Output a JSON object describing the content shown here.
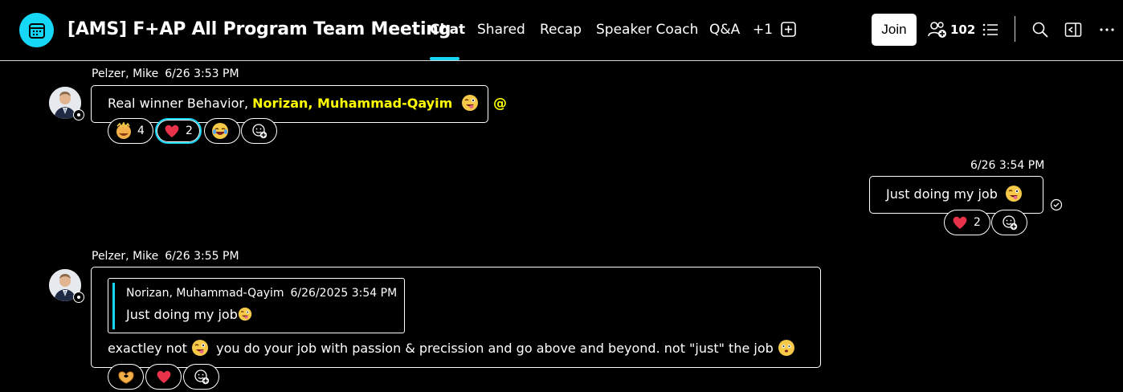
{
  "header": {
    "title": "[AMS] F+AP All Program Team Meeting",
    "tabs": [
      {
        "label": "Chat",
        "active": true
      },
      {
        "label": "Shared"
      },
      {
        "label": "Recap"
      },
      {
        "label": "Speaker Coach"
      },
      {
        "label": "Q&A"
      },
      {
        "label": "+1"
      }
    ],
    "join_label": "Join",
    "participant_count": "102",
    "accent": "#16d7f6"
  },
  "messages": [
    {
      "sender": "Pelzer, Mike",
      "time": "6/26 3:53 PM",
      "text_prefix": "Real winner Behavior, ",
      "mention": "Norizan, Muhammad-Qayim",
      "mention_symbol": "@",
      "reactions": [
        {
          "emoji": "clap-emoji",
          "count": "4"
        },
        {
          "emoji": "heart-emoji",
          "count": "2"
        },
        {
          "emoji": "laugh-emoji",
          "count": ""
        }
      ]
    },
    {
      "own": true,
      "time": "6/26 3:54 PM",
      "text": "Just doing my job",
      "reactions": [
        {
          "emoji": "heart-emoji",
          "count": "2"
        }
      ]
    },
    {
      "sender": "Pelzer, Mike",
      "time": "6/26 3:55 PM",
      "quote": {
        "author": "Norizan, Muhammad-Qayim",
        "time": "6/26/2025 3:54 PM",
        "text": "Just doing my job"
      },
      "text_part1": "exactley not ",
      "text_part2": " you do your job with passion & precission and go above and beyond. not \"just\" the job ",
      "reactions": [
        {
          "emoji": "heart-hands-emoji",
          "count": ""
        },
        {
          "emoji": "heart-emoji",
          "count": ""
        }
      ]
    }
  ]
}
